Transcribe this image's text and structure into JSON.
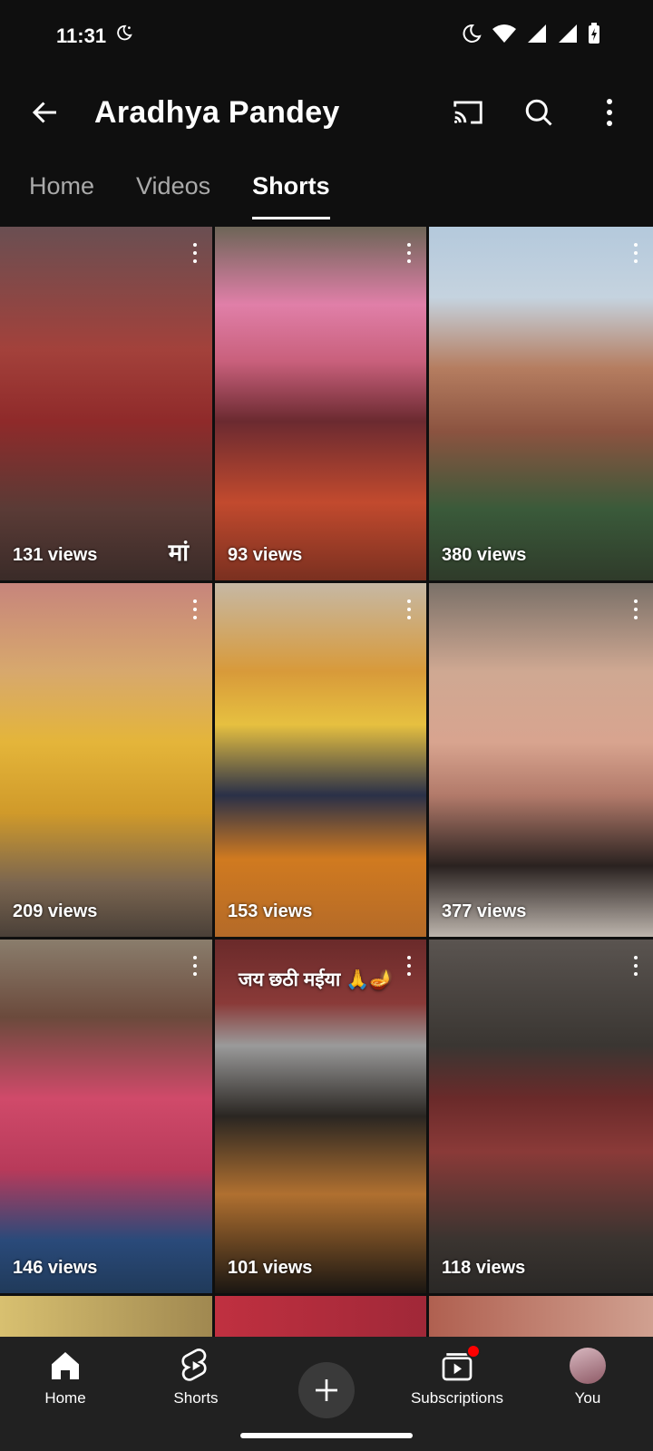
{
  "status_bar": {
    "time": "11:31"
  },
  "header": {
    "title": "Aradhya Pandey"
  },
  "tabs": [
    {
      "label": "Home",
      "active": false
    },
    {
      "label": "Videos",
      "active": false
    },
    {
      "label": "Shorts",
      "active": true
    }
  ],
  "shorts": [
    {
      "views": "131 views",
      "overlay": "मां"
    },
    {
      "views": "93 views"
    },
    {
      "views": "380 views"
    },
    {
      "views": "209 views"
    },
    {
      "views": "153 views"
    },
    {
      "views": "377 views"
    },
    {
      "views": "146 views"
    },
    {
      "views": "101 views",
      "overlay": "जय छठी मईया 🙏🪔"
    },
    {
      "views": "118 views"
    }
  ],
  "bottom_nav": {
    "home": "Home",
    "shorts": "Shorts",
    "subscriptions": "Subscriptions",
    "you": "You"
  },
  "colors": {
    "background": "#0f0f0f",
    "nav_background": "#212121",
    "badge": "#ff0000"
  }
}
